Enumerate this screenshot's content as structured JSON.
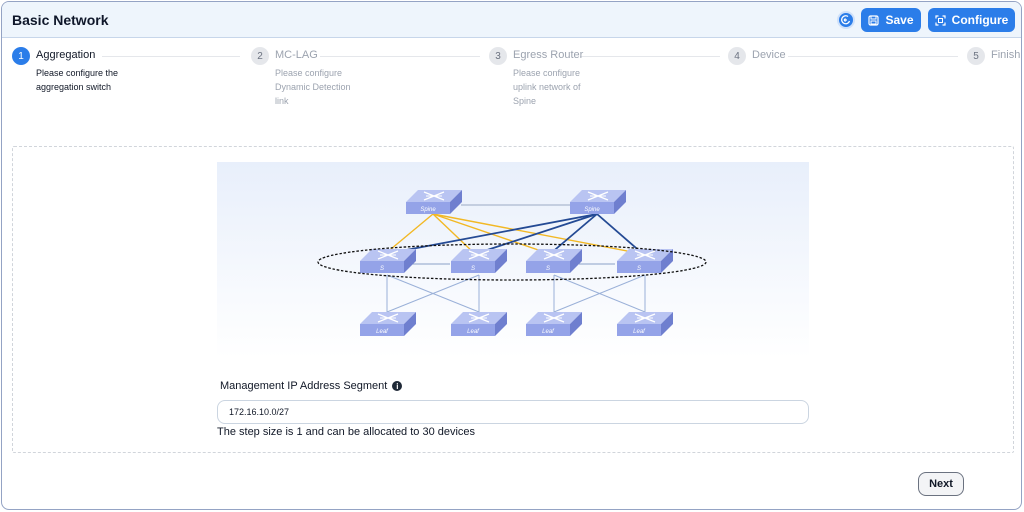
{
  "header": {
    "title": "Basic Network",
    "save_label": "Save",
    "configure_label": "Configure"
  },
  "steps": [
    {
      "num": "1",
      "title": "Aggregation",
      "desc": "Please configure the aggregation switch",
      "status": "active"
    },
    {
      "num": "2",
      "title": "MC-LAG",
      "desc": "Please configure Dynamic Detection link",
      "status": "pending"
    },
    {
      "num": "3",
      "title": "Egress Router",
      "desc": "Please configure uplink network of Spine",
      "status": "pending"
    },
    {
      "num": "4",
      "title": "Device",
      "desc": "",
      "status": "pending"
    },
    {
      "num": "5",
      "title": "Finish",
      "desc": "",
      "status": "pending"
    }
  ],
  "diagram": {
    "spine_label": "Spine",
    "aggregation_label": "S",
    "leaf_label": "Leaf"
  },
  "form": {
    "label": "Management IP Address Segment",
    "value": "172.16.10.0/27",
    "hint": "The step size is 1 and can be allocated to 30 devices"
  },
  "next_label": "Next",
  "colors": {
    "accent": "#2b7de9",
    "header_bg": "#eef5fc",
    "link_yellow": "#f2b824",
    "link_blue": "#244a94"
  }
}
